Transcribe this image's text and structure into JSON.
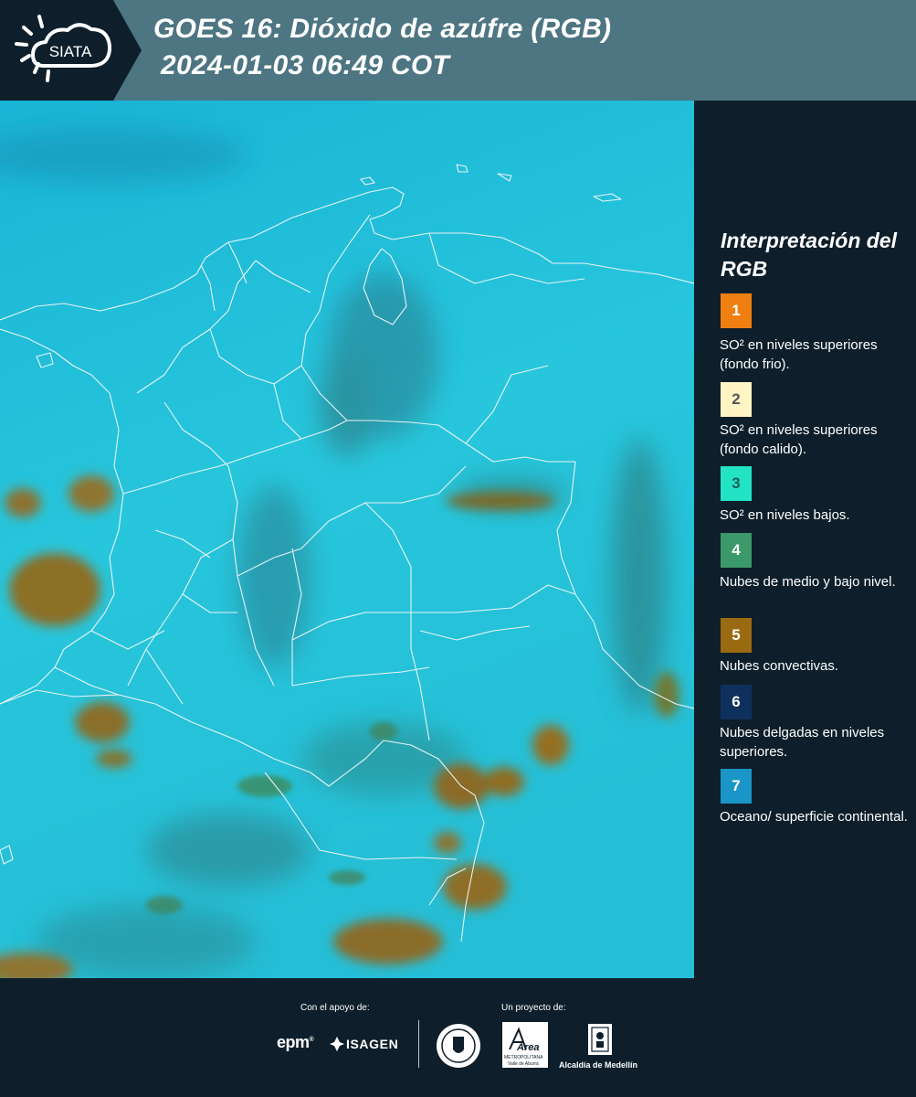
{
  "header": {
    "logo_text": "SIATA",
    "title_line1": "GOES 16: Dióxido de azúfre (RGB)",
    "title_line2": "2024-01-03 06:49 COT"
  },
  "legend": {
    "title": "Interpretación del RGB",
    "items": [
      {
        "number": "1",
        "color": "#f07f12",
        "text": "SO² en niveles superiores (fondo frio)."
      },
      {
        "number": "2",
        "color": "#fff5c4",
        "text": "SO² en niveles superiores (fondo calido)."
      },
      {
        "number": "3",
        "color": "#22e3c4",
        "text": "SO² en niveles bajos."
      },
      {
        "number": "4",
        "color": "#3c9969",
        "text": "Nubes de medio y bajo nivel."
      },
      {
        "number": "5",
        "color": "#9a6a10",
        "text": "Nubes convectivas."
      },
      {
        "number": "6",
        "color": "#0f305c",
        "text": "Nubes delgadas en niveles superiores."
      },
      {
        "number": "7",
        "color": "#1a95c7",
        "text": "Oceano/ superficie continental."
      }
    ]
  },
  "footer": {
    "support_label": "Con el apoyo de:",
    "project_label": "Un proyecto de:",
    "supporters": [
      "epm",
      "ISAGEN"
    ],
    "partners": {
      "area_name": "Área",
      "area_sub1": "METROPOLITANA",
      "area_sub2": "Valle de Aburrá",
      "alcaldia": "Alcaldía de Medellín"
    }
  },
  "colors": {
    "header_bg": "#4d7582",
    "logo_tab": "#0e1f2b",
    "panel_bg": "#0e1f2b",
    "ocean": "#22c3da",
    "clouds_convective": "#8f7428",
    "clouds_low": "#3a8a6a"
  }
}
